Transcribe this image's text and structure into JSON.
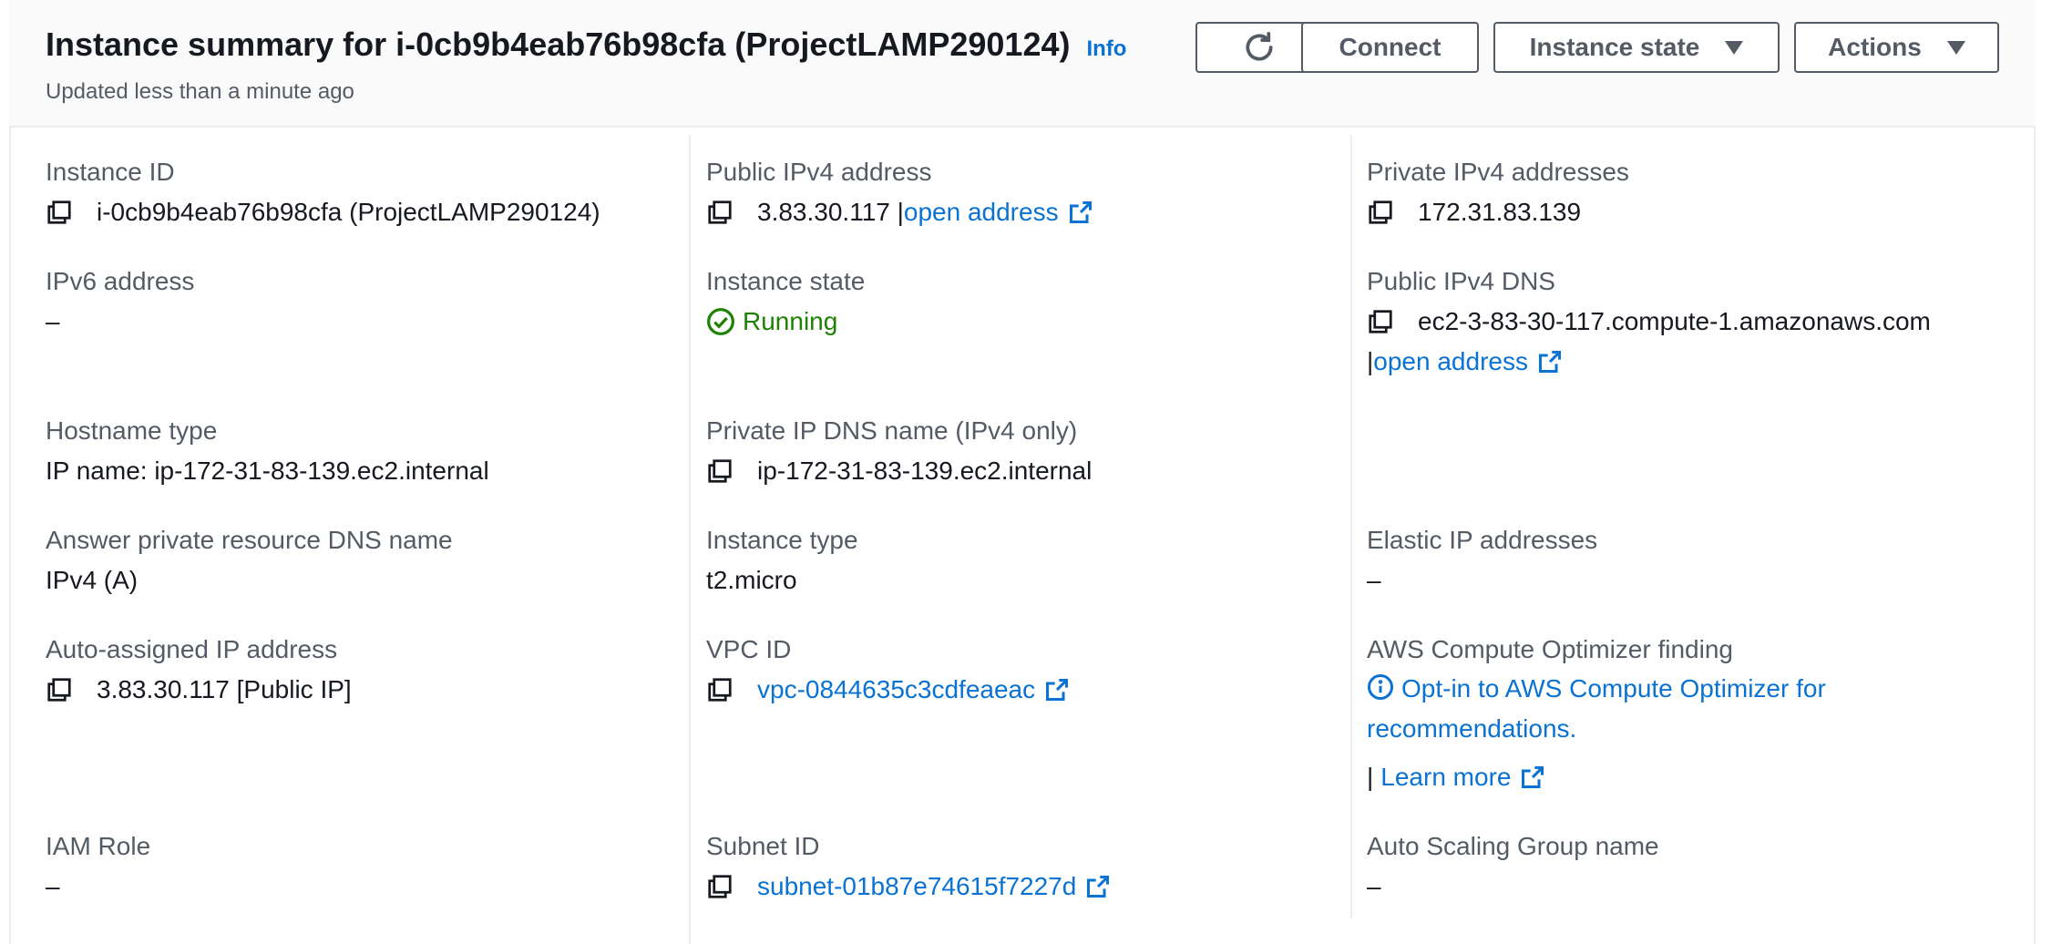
{
  "header": {
    "title": "Instance summary for i-0cb9b4eab76b98cfa (ProjectLAMP290124)",
    "info_link": "Info",
    "subtitle": "Updated less than a minute ago",
    "buttons": {
      "connect": "Connect",
      "instance_state": "Instance state",
      "actions": "Actions"
    }
  },
  "fields": {
    "instance_id": {
      "label": "Instance ID",
      "value": "i-0cb9b4eab76b98cfa (ProjectLAMP290124)"
    },
    "public_ipv4": {
      "label": "Public IPv4 address",
      "value": "3.83.30.117 |",
      "link": "open address"
    },
    "private_ipv4": {
      "label": "Private IPv4 addresses",
      "value": "172.31.83.139"
    },
    "ipv6": {
      "label": "IPv6 address",
      "value": "–"
    },
    "instance_state": {
      "label": "Instance state",
      "value": "Running"
    },
    "public_dns": {
      "label": "Public IPv4 DNS",
      "value": "ec2-3-83-30-117.compute-1.amazonaws.com",
      "prefix": "|",
      "link": "open address"
    },
    "hostname_type": {
      "label": "Hostname type",
      "value": "IP name: ip-172-31-83-139.ec2.internal"
    },
    "private_dns": {
      "label": "Private IP DNS name (IPv4 only)",
      "value": "ip-172-31-83-139.ec2.internal"
    },
    "answer_dns": {
      "label": "Answer private resource DNS name",
      "value": "IPv4 (A)"
    },
    "instance_type": {
      "label": "Instance type",
      "value": "t2.micro"
    },
    "elastic_ip": {
      "label": "Elastic IP addresses",
      "value": "–"
    },
    "auto_ip": {
      "label": "Auto-assigned IP address",
      "value": "3.83.30.117 [Public IP]"
    },
    "vpc_id": {
      "label": "VPC ID",
      "value": "vpc-0844635c3cdfeaeac"
    },
    "optimizer": {
      "label": "AWS Compute Optimizer finding",
      "value": "Opt-in to AWS Compute Optimizer for recommendations.",
      "prefix": "|",
      "link": "Learn more"
    },
    "iam_role": {
      "label": "IAM Role",
      "value": "–"
    },
    "subnet_id": {
      "label": "Subnet ID",
      "value": "subnet-01b87e74615f7227d"
    },
    "asg_name": {
      "label": "Auto Scaling Group name",
      "value": "–"
    }
  },
  "colors": {
    "link": "#0972d3",
    "running": "#1d8102",
    "label": "#545b64",
    "text": "#16191f"
  }
}
